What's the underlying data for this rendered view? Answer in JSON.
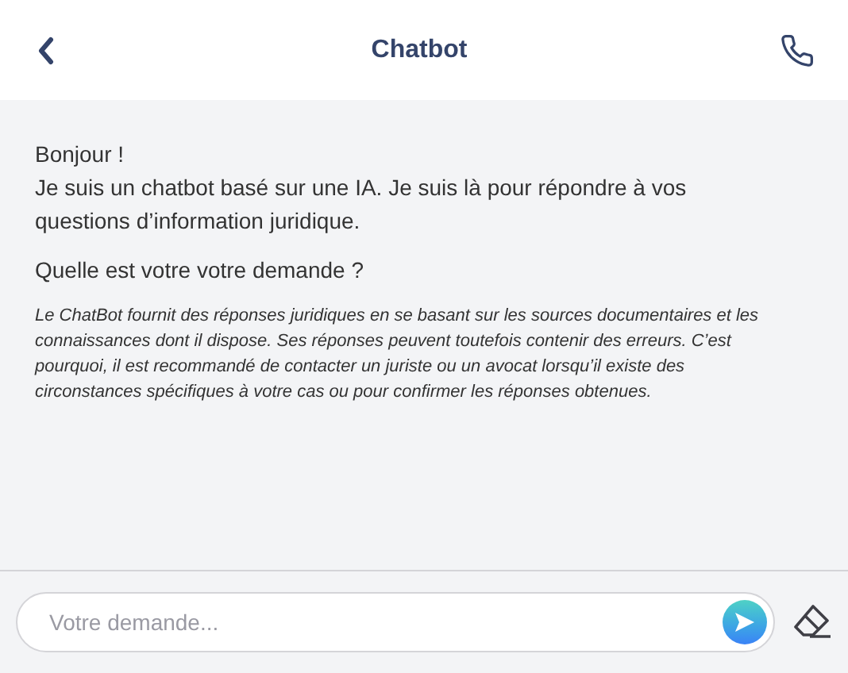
{
  "header": {
    "title": "Chatbot"
  },
  "messages": [
    {
      "kind": "text",
      "lines": [
        "Bonjour !",
        "Je suis un chatbot basé sur une IA. Je suis là pour répondre à vos questions d’information juridique."
      ]
    },
    {
      "kind": "text",
      "lines": [
        "Quelle est votre votre demande ?"
      ]
    },
    {
      "kind": "disclaimer",
      "lines": [
        "Le ChatBot fournit des réponses juridiques en se basant sur les sources documentaires et les connaissances dont il dispose. Ses réponses peuvent toutefois contenir des erreurs. C’est pourquoi, il est recommandé de contacter un juriste ou un avocat lorsqu’il existe des circonstances spécifiques à votre cas ou pour confirmer les réponses obtenues."
      ]
    }
  ],
  "composer": {
    "placeholder": "Votre demande..."
  }
}
